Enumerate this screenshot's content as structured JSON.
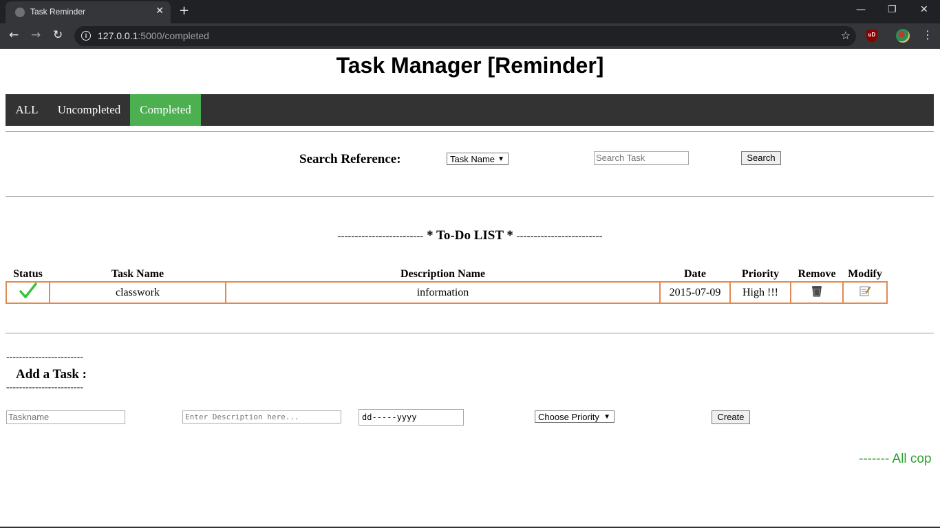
{
  "browser": {
    "tab_title": "Task Reminder",
    "tab_close": "✕",
    "new_tab": "+",
    "win_min": "—",
    "win_max": "❐",
    "win_close": "✕",
    "back": "←",
    "forward": "→",
    "reload": "↻",
    "url_host": "127.0.0.1",
    "url_rest": ":5000/completed",
    "star": "☆",
    "ext_label": "uD",
    "menu": "⋮"
  },
  "page_title": "Task Manager [Reminder]",
  "nav": {
    "items": [
      {
        "label": "ALL"
      },
      {
        "label": "Uncompleted"
      },
      {
        "label": "Completed"
      }
    ],
    "active_color": "#4CAF50"
  },
  "search": {
    "label": "Search Reference:",
    "select_value": "Task Name",
    "input_placeholder": "Search Task",
    "button_label": "Search"
  },
  "todo": {
    "title": "* To-Do LIST *",
    "dash": "-------------------------",
    "headers": [
      "Status",
      "Task Name",
      "Description Name",
      "Date",
      "Priority",
      "Remove",
      "Modify"
    ],
    "rows": [
      {
        "status_icon": "checkmark-icon",
        "task_name": "classwork",
        "description": "information",
        "date": "2015-07-09",
        "priority": "High !!!",
        "remove_icon": "trash-icon",
        "modify_icon": "edit-note-icon"
      }
    ],
    "border_color": "#e08a50"
  },
  "add_task": {
    "dash": "------------------------",
    "title": "Add a Task :",
    "taskname_placeholder": "Taskname",
    "description_placeholder": "Enter Description here...",
    "date_placeholder": "dd-----yyyy",
    "priority_select": "Choose Priority",
    "create_label": "Create"
  },
  "footer": {
    "text": "------- All cop",
    "color": "#2ca02c"
  }
}
